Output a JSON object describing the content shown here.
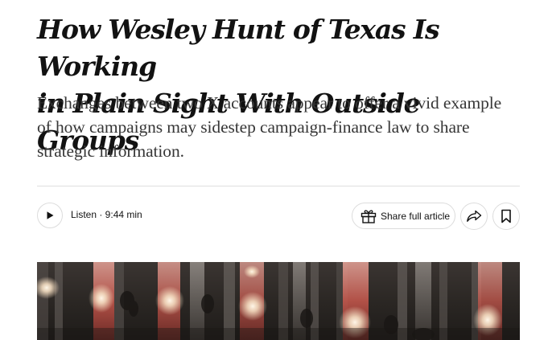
{
  "article": {
    "headline_line1": "How Wesley Hunt of Texas Is Working",
    "headline_line2": "in Plain Sight With Outside Groups",
    "summary": "Exchanges between two X accounts appear to offer a vivid example of how campaigns may sidestep campaign-finance law to share strategic information."
  },
  "toolbar": {
    "listen_label": "Listen · 9:44 min",
    "share_full_label": "Share full article"
  },
  "icons": {
    "play": "play-icon",
    "gift": "gift-icon",
    "share": "share-arrow-icon",
    "bookmark": "bookmark-icon"
  },
  "colors": {
    "text": "#121212",
    "summary_text": "#363636",
    "border": "#dcdcdc"
  }
}
